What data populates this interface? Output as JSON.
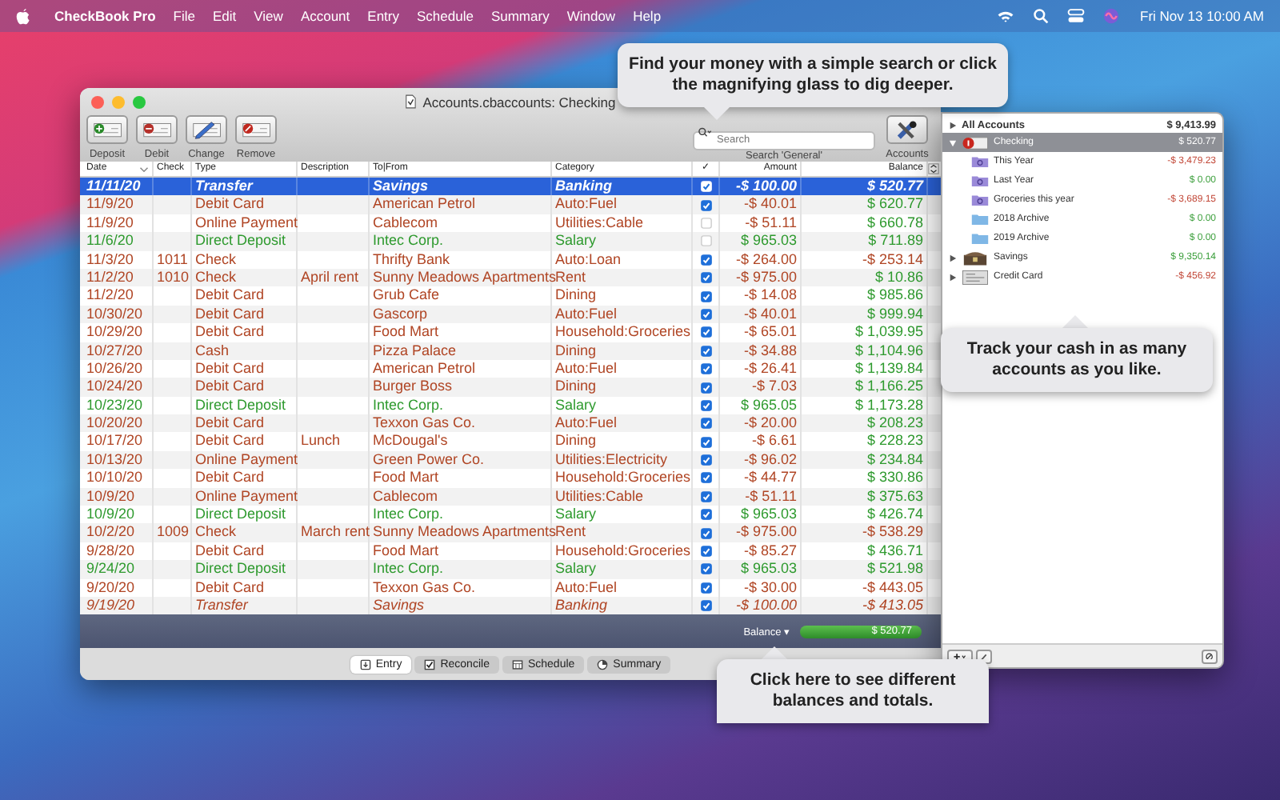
{
  "menu_bar": {
    "app_name": "CheckBook Pro",
    "menus": [
      "File",
      "Edit",
      "View",
      "Account",
      "Entry",
      "Schedule",
      "Summary",
      "Window",
      "Help"
    ],
    "clock": "Fri Nov 13  10:00 AM"
  },
  "window": {
    "title": "Accounts.cbaccounts: Checking"
  },
  "toolbar": {
    "buttons": [
      {
        "label": "Deposit",
        "kind": "deposit"
      },
      {
        "label": "Debit",
        "kind": "debit"
      },
      {
        "label": "Change",
        "kind": "change"
      },
      {
        "label": "Remove",
        "kind": "remove"
      }
    ],
    "search": {
      "placeholder": "Search",
      "label": "Search 'General'"
    },
    "accounts_button": "Accounts"
  },
  "table": {
    "columns": [
      "Date",
      "Check",
      "Type",
      "Description",
      "To|From",
      "Category",
      "✓",
      "Amount",
      "Balance"
    ],
    "rows": [
      {
        "date": "11/11/20",
        "type": "Transfer",
        "to_from": "Savings",
        "category": "Banking",
        "cleared": true,
        "amount": "-$ 100.00",
        "balance": "$ 520.77",
        "kind": "transfer",
        "overdrawn": false,
        "selected": true
      },
      {
        "date": "11/9/20",
        "type": "Debit Card",
        "to_from": "American Petrol",
        "category": "Auto:Fuel",
        "cleared": true,
        "amount": "-$ 40.01",
        "balance": "$ 620.77",
        "kind": "debit",
        "overdrawn": false,
        "selected": false
      },
      {
        "date": "11/9/20",
        "type": "Online Payment",
        "to_from": "Cablecom",
        "category": "Utilities:Cable",
        "cleared": false,
        "amount": "-$ 51.11",
        "balance": "$ 660.78",
        "kind": "debit",
        "overdrawn": false,
        "selected": false
      },
      {
        "date": "11/6/20",
        "type": "Direct Deposit",
        "to_from": "Intec Corp.",
        "category": "Salary",
        "cleared": false,
        "amount": "$ 965.03",
        "balance": "$ 711.89",
        "kind": "deposit",
        "overdrawn": false,
        "selected": false
      },
      {
        "date": "11/3/20",
        "check": "1011",
        "type": "Check",
        "to_from": "Thrifty Bank",
        "category": "Auto:Loan",
        "cleared": true,
        "amount": "-$ 264.00",
        "balance": "-$ 253.14",
        "kind": "debit",
        "overdrawn": true,
        "selected": false
      },
      {
        "date": "11/2/20",
        "check": "1010",
        "type": "Check",
        "description": "April rent",
        "to_from": "Sunny Meadows Apartments",
        "category": "Rent",
        "cleared": true,
        "amount": "-$ 975.00",
        "balance": "$ 10.86",
        "kind": "debit",
        "overdrawn": false,
        "selected": false
      },
      {
        "date": "11/2/20",
        "type": "Debit Card",
        "to_from": "Grub Cafe",
        "category": "Dining",
        "cleared": true,
        "amount": "-$ 14.08",
        "balance": "$ 985.86",
        "kind": "debit",
        "overdrawn": false,
        "selected": false
      },
      {
        "date": "10/30/20",
        "type": "Debit Card",
        "to_from": "Gascorp",
        "category": "Auto:Fuel",
        "cleared": true,
        "amount": "-$ 40.01",
        "balance": "$ 999.94",
        "kind": "debit",
        "overdrawn": false,
        "selected": false
      },
      {
        "date": "10/29/20",
        "type": "Debit Card",
        "to_from": "Food Mart",
        "category": "Household:Groceries",
        "cleared": true,
        "amount": "-$ 65.01",
        "balance": "$ 1,039.95",
        "kind": "debit",
        "overdrawn": false,
        "selected": false
      },
      {
        "date": "10/27/20",
        "type": "Cash",
        "to_from": "Pizza Palace",
        "category": "Dining",
        "cleared": true,
        "amount": "-$ 34.88",
        "balance": "$ 1,104.96",
        "kind": "debit",
        "overdrawn": false,
        "selected": false
      },
      {
        "date": "10/26/20",
        "type": "Debit Card",
        "to_from": "American Petrol",
        "category": "Auto:Fuel",
        "cleared": true,
        "amount": "-$ 26.41",
        "balance": "$ 1,139.84",
        "kind": "debit",
        "overdrawn": false,
        "selected": false
      },
      {
        "date": "10/24/20",
        "type": "Debit Card",
        "to_from": "Burger Boss",
        "category": "Dining",
        "cleared": true,
        "amount": "-$ 7.03",
        "balance": "$ 1,166.25",
        "kind": "debit",
        "overdrawn": false,
        "selected": false
      },
      {
        "date": "10/23/20",
        "type": "Direct Deposit",
        "to_from": "Intec Corp.",
        "category": "Salary",
        "cleared": true,
        "amount": "$ 965.05",
        "balance": "$ 1,173.28",
        "kind": "deposit",
        "overdrawn": false,
        "selected": false
      },
      {
        "date": "10/20/20",
        "type": "Debit Card",
        "to_from": "Texxon Gas Co.",
        "category": "Auto:Fuel",
        "cleared": true,
        "amount": "-$ 20.00",
        "balance": "$ 208.23",
        "kind": "debit",
        "overdrawn": false,
        "selected": false
      },
      {
        "date": "10/17/20",
        "type": "Debit Card",
        "description": "Lunch",
        "to_from": "McDougal's",
        "category": "Dining",
        "cleared": true,
        "amount": "-$ 6.61",
        "balance": "$ 228.23",
        "kind": "debit",
        "overdrawn": false,
        "selected": false
      },
      {
        "date": "10/13/20",
        "type": "Online Payment",
        "to_from": "Green Power Co.",
        "category": "Utilities:Electricity",
        "cleared": true,
        "amount": "-$ 96.02",
        "balance": "$ 234.84",
        "kind": "debit",
        "overdrawn": false,
        "selected": false
      },
      {
        "date": "10/10/20",
        "type": "Debit Card",
        "to_from": "Food Mart",
        "category": "Household:Groceries",
        "cleared": true,
        "amount": "-$ 44.77",
        "balance": "$ 330.86",
        "kind": "debit",
        "overdrawn": false,
        "selected": false
      },
      {
        "date": "10/9/20",
        "type": "Online Payment",
        "to_from": "Cablecom",
        "category": "Utilities:Cable",
        "cleared": true,
        "amount": "-$ 51.11",
        "balance": "$ 375.63",
        "kind": "debit",
        "overdrawn": false,
        "selected": false
      },
      {
        "date": "10/9/20",
        "type": "Direct Deposit",
        "to_from": "Intec Corp.",
        "category": "Salary",
        "cleared": true,
        "amount": "$ 965.03",
        "balance": "$ 426.74",
        "kind": "deposit",
        "overdrawn": false,
        "selected": false
      },
      {
        "date": "10/2/20",
        "check": "1009",
        "type": "Check",
        "description": "March rent",
        "to_from": "Sunny Meadows Apartments",
        "category": "Rent",
        "cleared": true,
        "amount": "-$ 975.00",
        "balance": "-$ 538.29",
        "kind": "debit",
        "overdrawn": true,
        "selected": false
      },
      {
        "date": "9/28/20",
        "type": "Debit Card",
        "to_from": "Food Mart",
        "category": "Household:Groceries",
        "cleared": true,
        "amount": "-$ 85.27",
        "balance": "$ 436.71",
        "kind": "debit",
        "overdrawn": false,
        "selected": false
      },
      {
        "date": "9/24/20",
        "type": "Direct Deposit",
        "to_from": "Intec Corp.",
        "category": "Salary",
        "cleared": true,
        "amount": "$ 965.03",
        "balance": "$ 521.98",
        "kind": "deposit",
        "overdrawn": false,
        "selected": false
      },
      {
        "date": "9/20/20",
        "type": "Debit Card",
        "to_from": "Texxon Gas Co.",
        "category": "Auto:Fuel",
        "cleared": true,
        "amount": "-$ 30.00",
        "balance": "-$ 443.05",
        "kind": "debit",
        "overdrawn": true,
        "selected": false
      },
      {
        "date": "9/19/20",
        "type": "Transfer",
        "to_from": "Savings",
        "category": "Banking",
        "cleared": true,
        "amount": "-$ 100.00",
        "balance": "-$ 413.05",
        "kind": "transfer",
        "overdrawn": true,
        "selected": false
      }
    ]
  },
  "footer": {
    "balance_menu": "Balance ▾",
    "balance_value": "$ 520.77"
  },
  "view_tabs": [
    {
      "label": "Entry",
      "kind": "entry",
      "selected": true
    },
    {
      "label": "Reconcile",
      "kind": "reconcile",
      "selected": false
    },
    {
      "label": "Schedule",
      "kind": "schedule",
      "selected": false
    },
    {
      "label": "Summary",
      "kind": "summary",
      "selected": false
    }
  ],
  "accounts_panel": {
    "total": {
      "label": "All Accounts",
      "amount": "$ 9,413.99"
    },
    "accounts": [
      {
        "name": "Checking",
        "kind": "checking",
        "amount": "$ 520.77",
        "selected": true,
        "expanded": true,
        "children": [
          {
            "name": "This Year",
            "kind": "smart",
            "amount": "-$ 3,479.23",
            "negative": true
          },
          {
            "name": "Last Year",
            "kind": "smart",
            "amount": "$ 0.00",
            "negative": false
          },
          {
            "name": "Groceries this year",
            "kind": "smart",
            "amount": "-$ 3,689.15",
            "negative": true
          },
          {
            "name": "2018 Archive",
            "kind": "folder",
            "amount": "$ 0.00",
            "negative": false
          },
          {
            "name": "2019 Archive",
            "kind": "folder",
            "amount": "$ 0.00",
            "negative": false
          }
        ]
      },
      {
        "name": "Savings",
        "kind": "savings",
        "amount": "$ 9,350.14",
        "selected": false,
        "expanded": false,
        "negative": false
      },
      {
        "name": "Credit Card",
        "kind": "credit",
        "amount": "-$ 456.92",
        "selected": false,
        "expanded": false,
        "negative": true
      }
    ]
  },
  "callouts": [
    {
      "text": "Find your money with a simple search or click the magnifying glass to dig deeper."
    },
    {
      "text": "Track your cash in as many accounts as you like."
    },
    {
      "text": "Click here to see different balances and totals."
    }
  ]
}
